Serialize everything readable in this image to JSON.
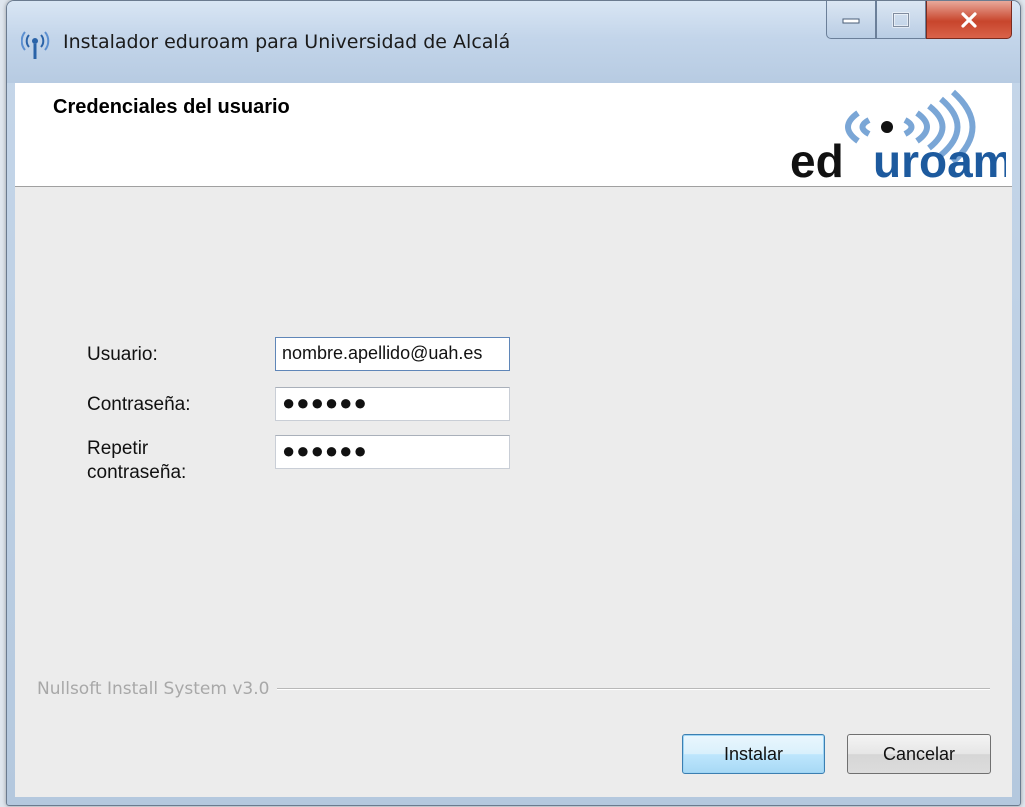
{
  "window": {
    "title": "Instalador eduroam para Universidad de Alcalá"
  },
  "header": {
    "title": "Credenciales del usuario",
    "logo_text_dark": "ed",
    "logo_text_brand": "uroam",
    "logo_icon": "eduroam-logo"
  },
  "form": {
    "user_label": "Usuario:",
    "user_value": "nombre.apellido@uah.es",
    "password_label": "Contraseña:",
    "password_value": "●●●●●●",
    "repeat_label_line1": "Repetir",
    "repeat_label_line2": "contraseña:",
    "repeat_value": "●●●●●●"
  },
  "footer": {
    "branding": "Nullsoft Install System v3.0",
    "install_label": "Instalar",
    "cancel_label": "Cancelar"
  },
  "colors": {
    "brand_blue": "#1d5a9e",
    "close_red": "#c8452c",
    "default_button_border": "#3c7fb1"
  }
}
